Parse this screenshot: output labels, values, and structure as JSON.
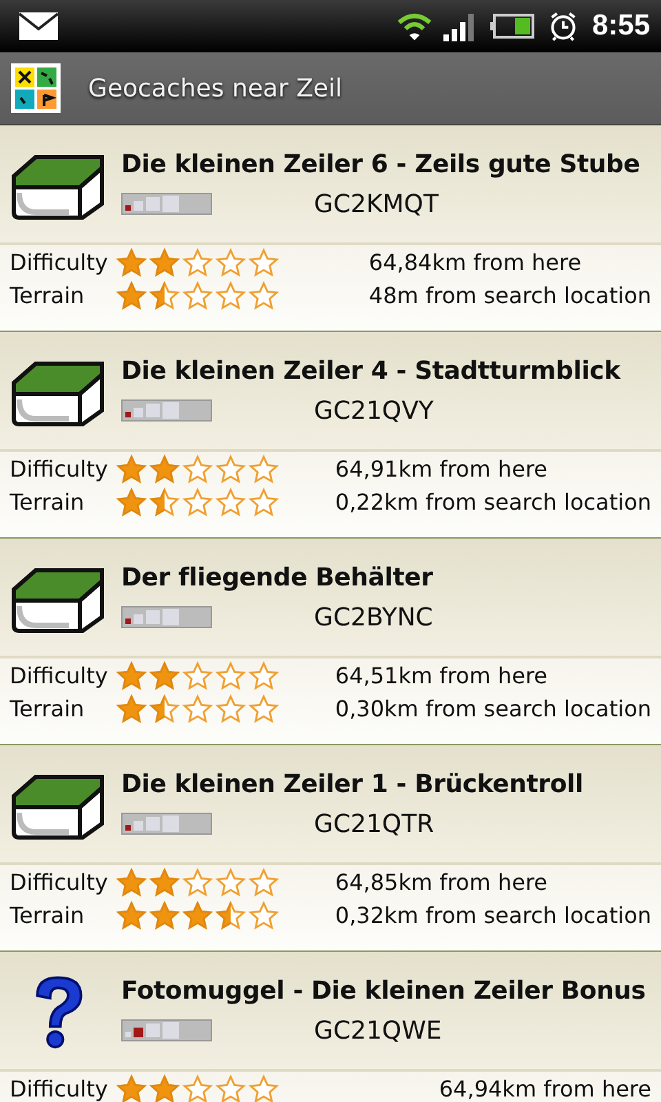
{
  "status_bar": {
    "time": "8:55"
  },
  "title_bar": {
    "title": "Geocaches near Zeil"
  },
  "caches": [
    {
      "kind": "container",
      "name": "Die kleinen Zeiler 6 - Zeils  gute Stube",
      "code": "GC2KMQT",
      "size": [
        {
          "selected": true
        },
        {
          "selected": false
        },
        {
          "selected": false
        },
        {
          "selected": false
        }
      ],
      "difficulty_label": "Difficulty",
      "difficulty": {
        "stars": 2
      },
      "terrain_label": "Terrain",
      "terrain": {
        "stars": 1.5
      },
      "distance": "64,84km from here",
      "search_distance": "48m from search location"
    },
    {
      "kind": "container",
      "name": "Die kleinen Zeiler 4 - Stadtturmblick",
      "code": "GC21QVY",
      "size": [
        {
          "selected": true
        },
        {
          "selected": false
        },
        {
          "selected": false
        },
        {
          "selected": false
        }
      ],
      "difficulty_label": "Difficulty",
      "difficulty": {
        "stars": 2
      },
      "terrain_label": "Terrain",
      "terrain": {
        "stars": 1.5
      },
      "distance": "64,91km from here",
      "search_distance": "0,22km from search location"
    },
    {
      "kind": "container",
      "name": "Der fliegende Behälter",
      "code": "GC2BYNC",
      "size": [
        {
          "selected": true
        },
        {
          "selected": false
        },
        {
          "selected": false
        },
        {
          "selected": false
        }
      ],
      "difficulty_label": "Difficulty",
      "difficulty": {
        "stars": 2
      },
      "terrain_label": "Terrain",
      "terrain": {
        "stars": 1.5
      },
      "distance": "64,51km from here",
      "search_distance": "0,30km from search location"
    },
    {
      "kind": "container",
      "name": "Die kleinen Zeiler 1 - Brückentroll",
      "code": "GC21QTR",
      "size": [
        {
          "selected": true
        },
        {
          "selected": false
        },
        {
          "selected": false
        },
        {
          "selected": false
        }
      ],
      "difficulty_label": "Difficulty",
      "difficulty": {
        "stars": 2
      },
      "terrain_label": "Terrain",
      "terrain": {
        "stars": 3.5
      },
      "distance": "64,85km from here",
      "search_distance": "0,32km from search location"
    },
    {
      "kind": "question",
      "name": "Fotomuggel - Die kleinen Zeiler Bonus",
      "code": "GC21QWE",
      "size": [
        {
          "selected": false
        },
        {
          "selected": true
        },
        {
          "selected": false
        },
        {
          "selected": false
        }
      ],
      "difficulty_label": "Difficulty",
      "difficulty": {
        "stars": 2
      },
      "distance": "64,94km from here"
    }
  ]
}
